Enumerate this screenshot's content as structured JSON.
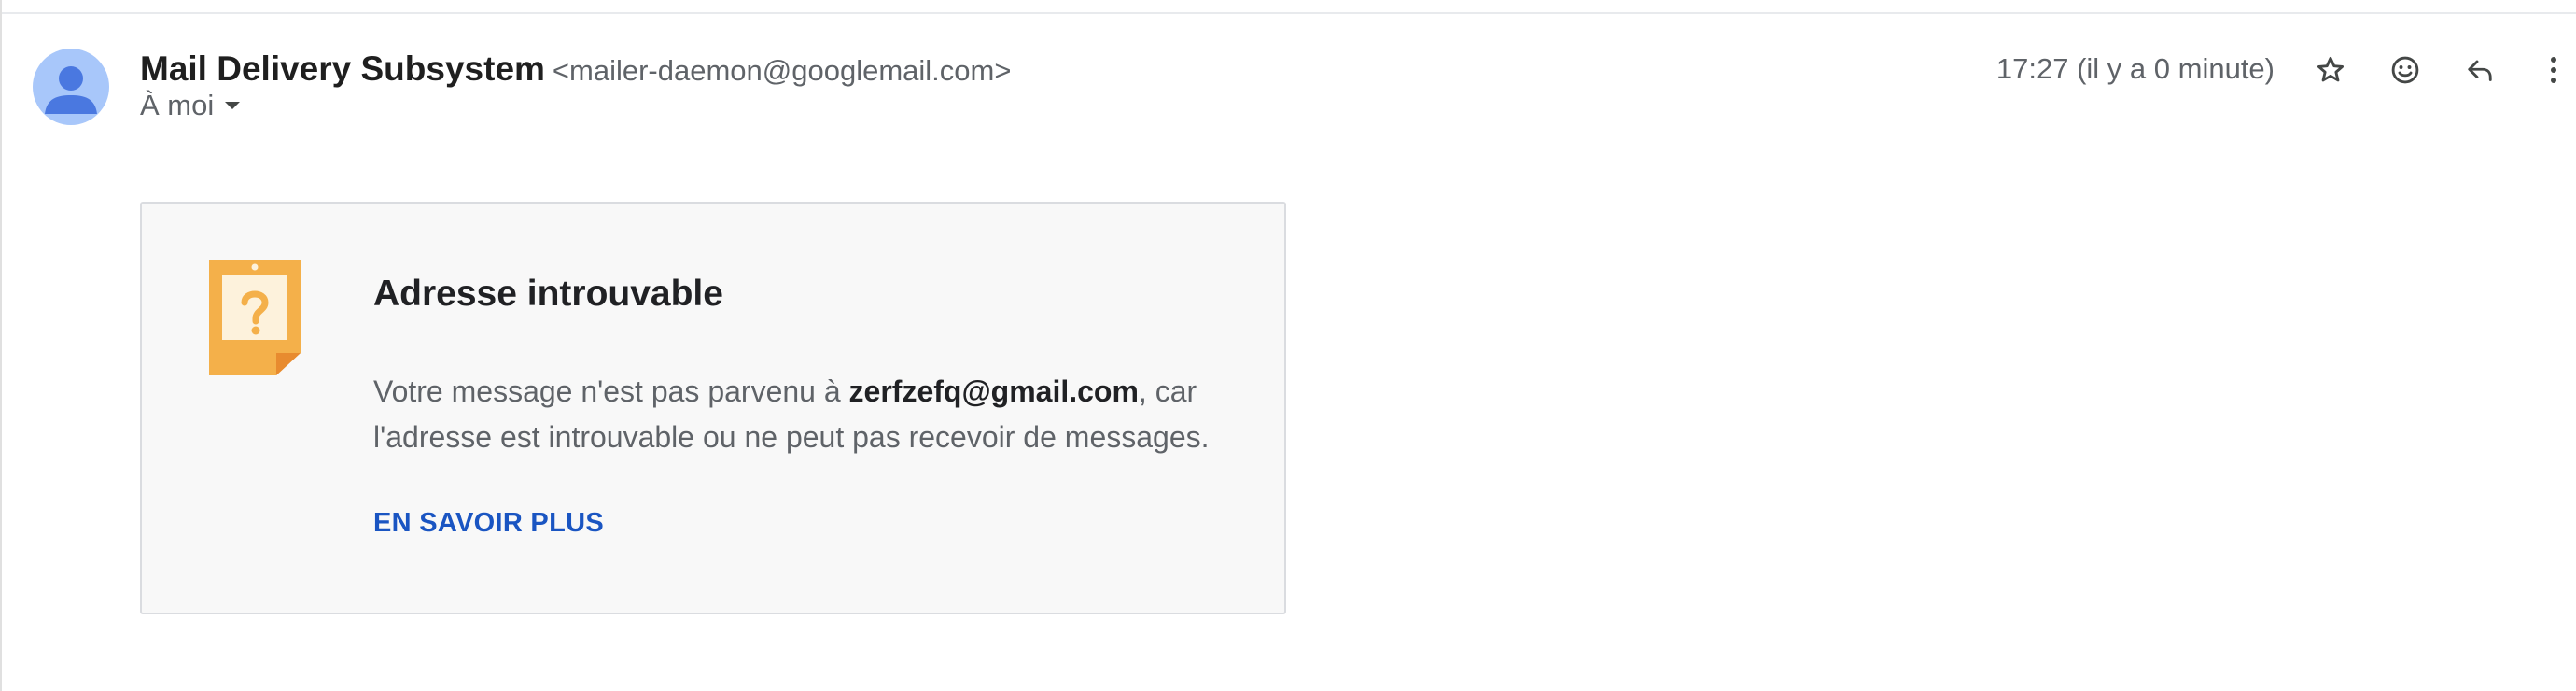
{
  "message": {
    "sender_name": "Mail Delivery Subsystem",
    "sender_email": "<mailer-daemon@googlemail.com>",
    "recipient_label": "À moi",
    "timestamp": "17:27 (il y a 0 minute)"
  },
  "actions": {
    "icons": [
      "star-icon",
      "emoji-icon",
      "reply-icon",
      "more-vert-icon"
    ]
  },
  "notice": {
    "icon": "question-note-icon",
    "title": "Adresse introuvable",
    "body_before": "Votre message n'est pas parvenu à ",
    "body_address": "zerfzefq@gmail.com",
    "body_after": ", car l'adresse est introuvable ou ne peut pas recevoir de messages.",
    "link_label": "EN SAVOIR PLUS"
  },
  "colors": {
    "avatar_bg": "#a8c7fa",
    "avatar_fg": "#4a78e0",
    "link": "#1a55c2",
    "note_orange": "#f4b04a",
    "note_fold": "#e88b2f"
  }
}
